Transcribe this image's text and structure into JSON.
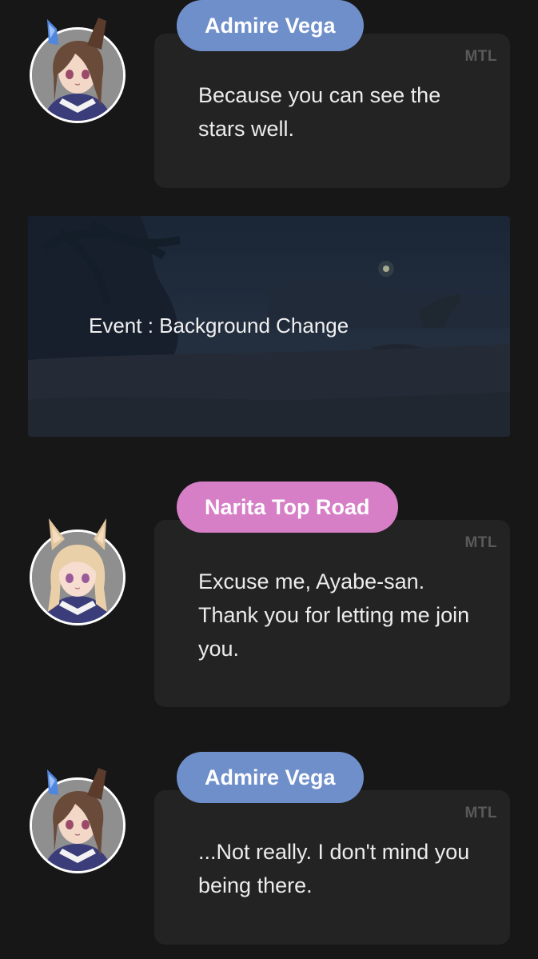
{
  "messages": [
    {
      "speaker": "Admire Vega",
      "badge": "MTL",
      "text": "Because you can see the stars well.",
      "pill_color": "#6f8fcb"
    },
    {
      "speaker": "Narita Top Road",
      "badge": "MTL",
      "text": "Excuse me, Ayabe-san. Thank you for letting me join you.",
      "pill_color": "#d67fc7"
    },
    {
      "speaker": "Admire Vega",
      "badge": "MTL",
      "text": "...Not really. I don't mind you being there.",
      "pill_color": "#6f8fcb"
    }
  ],
  "event": {
    "label": "Event : Background Change"
  },
  "colors": {
    "background": "#171717",
    "bubble": "#232323",
    "badge_text": "#5a5a5a",
    "admire_vega": "#6f8fcb",
    "narita_top_road": "#d67fc7"
  },
  "icons": {
    "avatar_1": "admire-vega-portrait",
    "avatar_2": "narita-top-road-portrait",
    "avatar_3": "admire-vega-portrait"
  }
}
